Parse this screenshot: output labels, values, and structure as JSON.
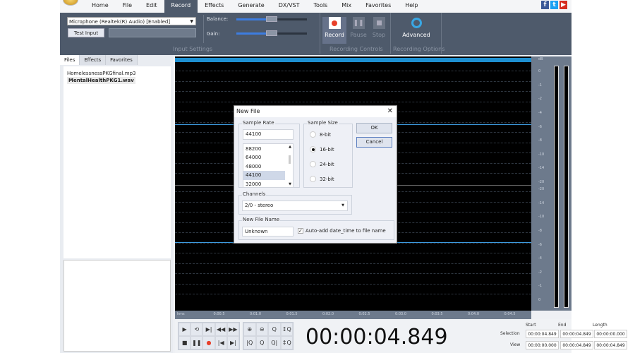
{
  "menu": [
    "Home",
    "File",
    "Edit",
    "Record",
    "Effects",
    "Generate",
    "DX/VST",
    "Tools",
    "Mix",
    "Favorites",
    "Help"
  ],
  "menu_active": "Record",
  "social": [
    {
      "name": "facebook",
      "glyph": "f",
      "color": "#3b5998"
    },
    {
      "name": "twitter",
      "glyph": "t",
      "color": "#1da1f2"
    },
    {
      "name": "youtube",
      "glyph": "▶",
      "color": "#d62d20"
    }
  ],
  "input_settings": {
    "device": "Microphone (Realtek(R) Audio) [Enabled]",
    "test_input": "Test Input",
    "balance_label": "Balance:",
    "gain_label": "Gain:",
    "balance_level": 0.5,
    "gain_level": 0.5,
    "group_label": "Input Settings"
  },
  "recording_controls": {
    "record": "Record",
    "pause": "Pause",
    "stop": "Stop",
    "group_label": "Recording Controls"
  },
  "recording_options": {
    "advanced": "Advanced",
    "group_label": "Recording Options"
  },
  "left_tabs": [
    "Files",
    "Effects",
    "Favorites"
  ],
  "files": [
    "HomelessnessPKGfinal.mp3",
    "MentalHealthPKG1.wav"
  ],
  "db_scale": {
    "unit": "dB",
    "ticks": [
      "0",
      "-1",
      "-2",
      "-4",
      "-6",
      "-8",
      "-10",
      "-14",
      "-20",
      "-20",
      "-14",
      "-10",
      "-8",
      "-6",
      "-4",
      "-2",
      "-1",
      "0"
    ]
  },
  "timeline": [
    "hms",
    "0:00.5",
    "0:01.0",
    "0:01.5",
    "0:02.0",
    "0:02.5",
    "0:03.0",
    "0:03.5",
    "0:04.0",
    "0:04.5"
  ],
  "clock": "00:00:04.849",
  "selection": {
    "start_label": "Start",
    "end_label": "End",
    "length_label": "Length",
    "selection_label": "Selection",
    "view_label": "View",
    "sel_start": "00:00:04.849",
    "sel_end": "00:00:04.849",
    "sel_length": "00:00:00.000",
    "view_start": "00:00:00.000",
    "view_end": "00:00:04.849",
    "view_length": "00:00:04.849"
  },
  "dialog": {
    "title": "New File",
    "sample_rate_label": "Sample Rate",
    "sample_rate_value": "44100",
    "rates": [
      "88200",
      "64000",
      "48000",
      "44100",
      "32000"
    ],
    "selected_rate": "44100",
    "sample_size_label": "Sample Size",
    "sizes": [
      "8-bit",
      "16-bit",
      "24-bit",
      "32-bit"
    ],
    "selected_size": "16-bit",
    "ok": "OK",
    "cancel": "Cancel",
    "channels_label": "Channels",
    "channels_value": "2/0 - stereo",
    "file_name_label": "New File Name",
    "file_name_value": "Unknown",
    "auto_add_label": "Auto-add date_time to file name",
    "auto_add_checked": true
  },
  "colors": {
    "ribbon": "#4e5a6b",
    "accent": "#3d9be0",
    "record_red": "#e8402a"
  }
}
